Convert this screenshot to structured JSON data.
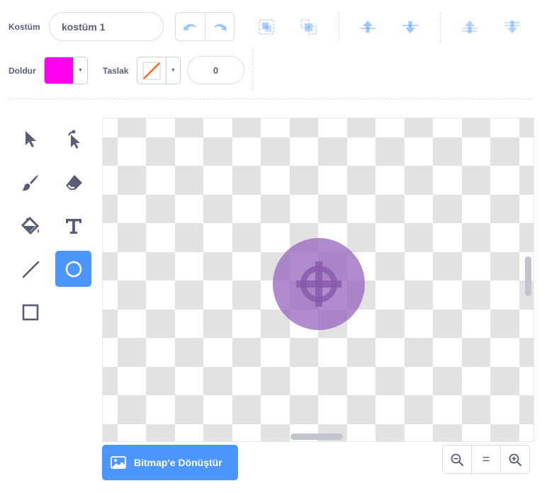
{
  "costume": {
    "label": "Kostüm",
    "value": "kostüm 1"
  },
  "fill": {
    "label": "Doldur",
    "color": "#ff00ef"
  },
  "outline": {
    "label": "Taslak",
    "width_value": "0",
    "state": "none"
  },
  "toolbar_icons": [
    "undo-icon",
    "redo-icon",
    "group-icon",
    "ungroup-icon",
    "forward-icon",
    "backward-icon",
    "front-icon",
    "back-icon"
  ],
  "tools": {
    "items": [
      "select",
      "reshape",
      "brush",
      "eraser",
      "fill",
      "text",
      "line",
      "circle",
      "rectangle"
    ],
    "active": "circle"
  },
  "convert_button": {
    "label": "Bitmap'e Dönüştür"
  },
  "zoom": {
    "reset_label": "="
  },
  "colors": {
    "accent": "#4c97ff",
    "text": "#575e75",
    "sprite": "#9966bf"
  }
}
